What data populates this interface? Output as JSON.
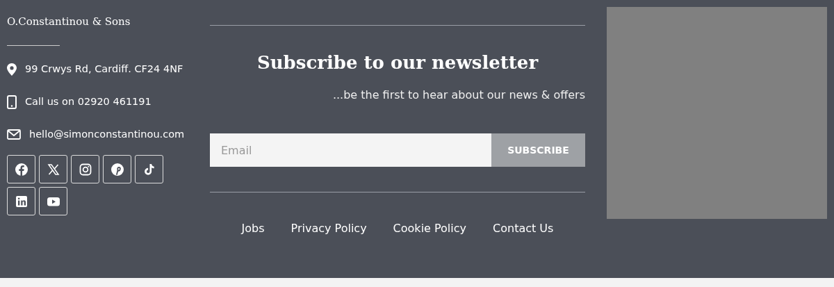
{
  "brand": {
    "name": "O.Constantinou & Sons"
  },
  "contacts": [
    {
      "kind": "location",
      "text": "99 Crwys Rd, Cardiff. CF24 4NF"
    },
    {
      "kind": "phone",
      "text": "Call us on 02920 461191"
    },
    {
      "kind": "email",
      "text": "hello@simonconstantinou.com"
    }
  ],
  "social": [
    {
      "kind": "facebook"
    },
    {
      "kind": "x"
    },
    {
      "kind": "instagram"
    },
    {
      "kind": "pinterest"
    },
    {
      "kind": "tiktok"
    },
    {
      "kind": "linkedin"
    },
    {
      "kind": "youtube"
    }
  ],
  "newsletter": {
    "title": "Subscribe to our newsletter",
    "subtitle": "...be the first to hear about our news & offers",
    "email": {
      "placeholder": "Email"
    },
    "button": "SUBSCRIBE"
  },
  "links": [
    "Jobs",
    "Privacy Policy",
    "Cookie Policy",
    "Contact Us"
  ],
  "image": {
    "kind": "placeholder"
  }
}
